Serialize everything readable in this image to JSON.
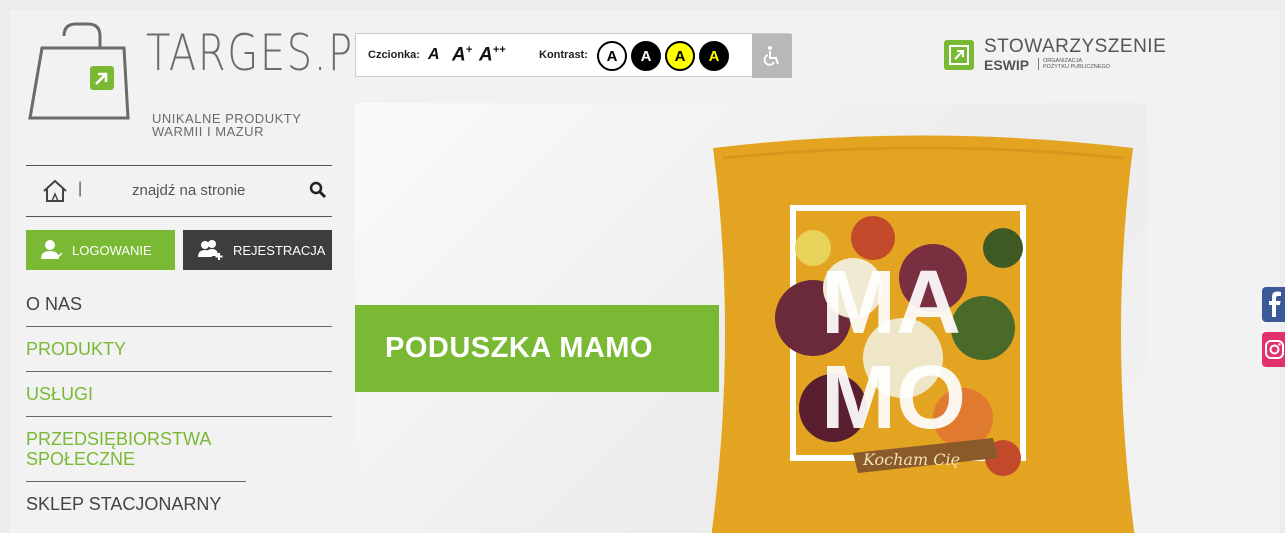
{
  "logo": {
    "name": "TARGES.PL",
    "tagline_line1": "UNIKALNE PRODUKTY",
    "tagline_line2": "WARMII I MAZUR"
  },
  "search": {
    "placeholder": "znajdź na stronie",
    "separator": "|"
  },
  "auth": {
    "login_label": "LOGOWANIE",
    "register_label": "REJESTRACJA"
  },
  "nav": {
    "items": [
      {
        "label": "O NAS"
      },
      {
        "label": "PRODUKTY"
      },
      {
        "label": "USŁUGI"
      },
      {
        "label": "PRZEDSIĘBIORSTWA SPOŁECZNE"
      },
      {
        "label": "SKLEP STACJONARNY"
      }
    ]
  },
  "accessibility": {
    "font_label": "Czcionka:",
    "font_a": "A",
    "font_a_plus": "A",
    "font_a_plus_sup": "+",
    "font_a_plusplus": "A",
    "font_a_plusplus_sup": "++",
    "contrast_label": "Kontrast:",
    "contrast_options": [
      {
        "label": "A"
      },
      {
        "label": "A"
      },
      {
        "label": "A"
      },
      {
        "label": "A"
      }
    ]
  },
  "partner": {
    "title": "STOWARZYSZENIE",
    "name": "ESWIP",
    "sub_line1": "ORGANIZACJA",
    "sub_line2": "POŻYTKU PUBLICZNEGO"
  },
  "banner": {
    "title": "PODUSZKA MAMO",
    "pillow_text_1": "MA",
    "pillow_text_2": "MO",
    "pillow_ribbon": "Kocham Cię"
  },
  "colors": {
    "accent_green": "#7ab934",
    "dark": "#3d3d3d",
    "pillow_yellow": "#e3a422",
    "facebook": "#3b5998",
    "instagram": "#e1306c"
  },
  "icons": {
    "home": "home-icon",
    "search": "search-icon",
    "login": "user-icon",
    "register": "add-user-icon",
    "wheelchair": "wheelchair-icon",
    "facebook": "facebook-icon",
    "instagram": "instagram-icon"
  }
}
